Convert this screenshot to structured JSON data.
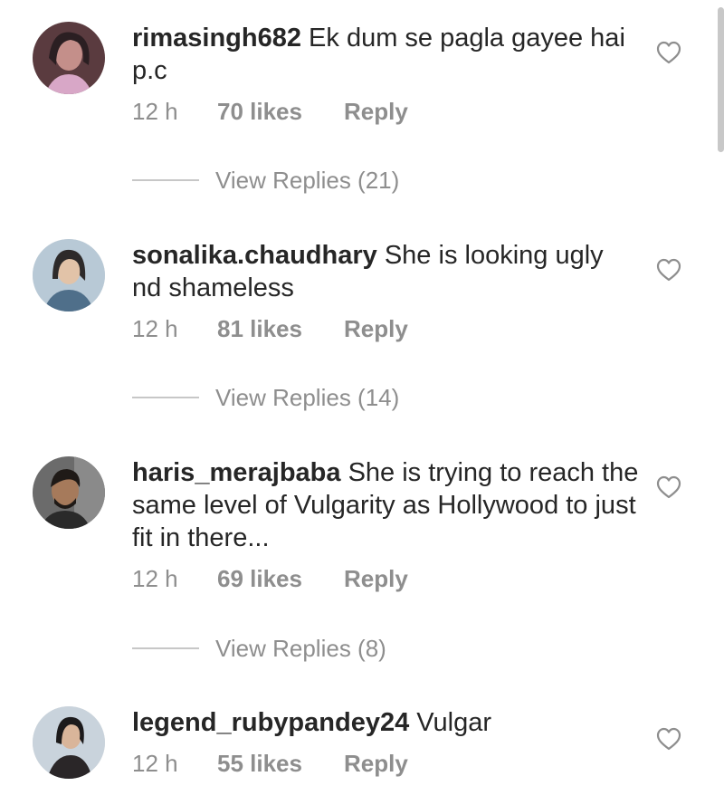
{
  "comments": [
    {
      "username": "rimasingh682",
      "text": " Ek dum se pagla gayee hai p.c",
      "time": "12 h",
      "likes": "70 likes",
      "reply": "Reply",
      "view_replies": "View Replies (21)",
      "avatar_colors": [
        "#5a3b3f",
        "#c48f8a",
        "#2b1f22"
      ]
    },
    {
      "username": "sonalika.chaudhary",
      "text": " She is looking ugly nd shameless",
      "time": "12 h",
      "likes": "81 likes",
      "reply": "Reply",
      "view_replies": "View Replies (14)",
      "avatar_colors": [
        "#b8c9d6",
        "#e2c3a8",
        "#2d2a2a"
      ]
    },
    {
      "username": "haris_merajbaba",
      "text": " She is trying to reach the same level of Vulgarity as Hollywood to just fit in there...",
      "time": "12 h",
      "likes": "69 likes",
      "reply": "Reply",
      "view_replies": "View Replies (8)",
      "avatar_colors": [
        "#6b6b6b",
        "#a67a5b",
        "#1f1a17"
      ]
    },
    {
      "username": "legend_rubypandey24",
      "text": " Vulgar",
      "time": "12 h",
      "likes": "55 likes",
      "reply": "Reply",
      "avatar_colors": [
        "#c9d3dc",
        "#d9b59a",
        "#1c1a1b"
      ]
    }
  ],
  "colors": {
    "primary_text": "#262626",
    "secondary_text": "#8e8e8e",
    "divider": "#c7c7c7"
  }
}
